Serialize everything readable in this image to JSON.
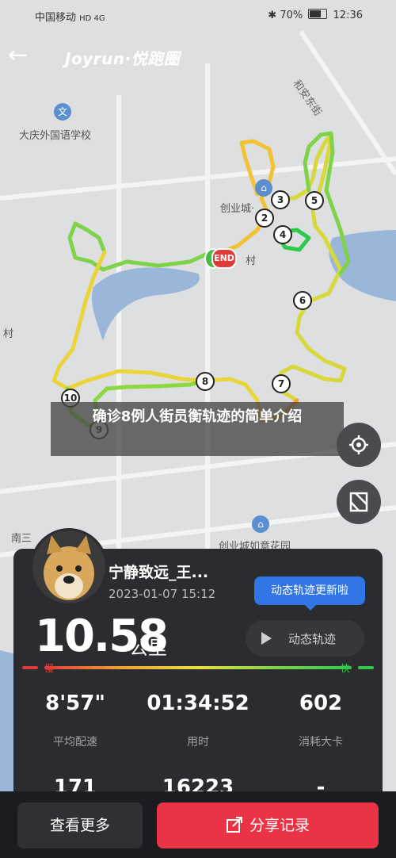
{
  "status_bar": {
    "carrier": "中国移动",
    "network": "HD 4G",
    "battery": "70%",
    "time": "12:36"
  },
  "header": {
    "brand": "Joyrun·悦跑圈"
  },
  "map": {
    "labels": {
      "school": "大庆外国语学校",
      "community_top": "创业城·",
      "village": "村",
      "village_left": "村",
      "street_ne": "和安东街",
      "south": "南三",
      "community_bottom": "创业城如意花园"
    },
    "markers": [
      "2",
      "3",
      "4",
      "5",
      "6",
      "7",
      "8",
      "9",
      "10"
    ],
    "end_label": "END"
  },
  "banner": {
    "text": "确诊8例人街员衡轨迹的简单介绍"
  },
  "card": {
    "username": "宁静致远_王...",
    "datetime": "2023-01-07 15:12",
    "bubble": "动态轨迹更新啦",
    "distance": "10.58",
    "unit": "公里",
    "dynamic_track_label": "动态轨迹",
    "speed_slow": "慢",
    "speed_fast": "快",
    "stats": [
      {
        "value": "8'57\"",
        "label": "平均配速"
      },
      {
        "value": "01:34:52",
        "label": "用时"
      },
      {
        "value": "602",
        "label": "消耗大卡"
      }
    ],
    "stats_row2": [
      "171",
      "16223",
      "-"
    ]
  },
  "actions": {
    "more": "查看更多",
    "share": "分享记录"
  },
  "colors": {
    "accent_red": "#ea3345",
    "accent_blue": "#3275e4",
    "card_bg": "#2b2c30"
  }
}
